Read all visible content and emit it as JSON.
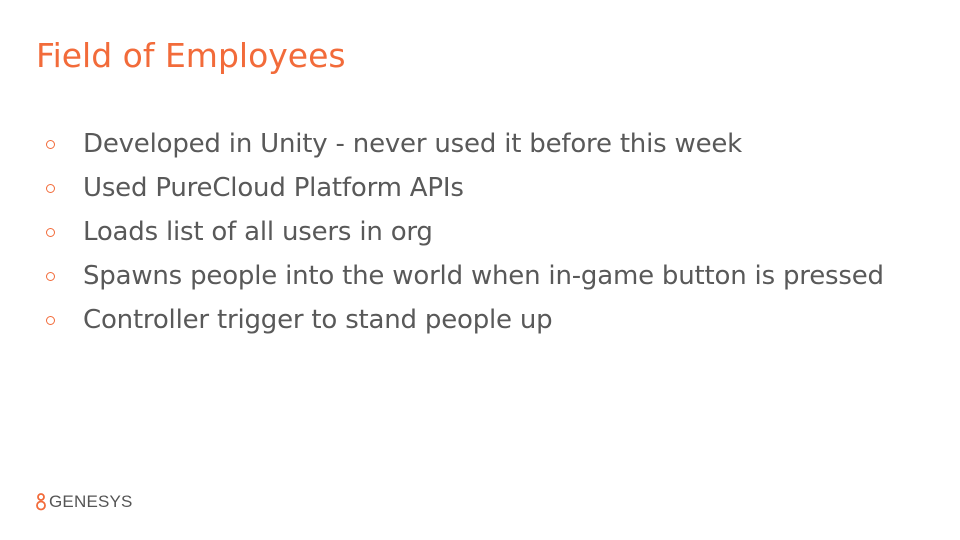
{
  "slide": {
    "title": "Field of Employees",
    "bullets": [
      {
        "text": "Developed in Unity - never used it before this week"
      },
      {
        "text": "Used PureCloud Platform APIs"
      },
      {
        "text": "Loads list of all users in org"
      },
      {
        "text": "Spawns people into the world when in-game button is pressed"
      },
      {
        "text": "Controller trigger to stand people up"
      }
    ]
  },
  "logo": {
    "text": "GENESYS",
    "icon": "genesys-logo-icon"
  },
  "colors": {
    "accent": "#f26b3a",
    "body_text": "#595959"
  }
}
